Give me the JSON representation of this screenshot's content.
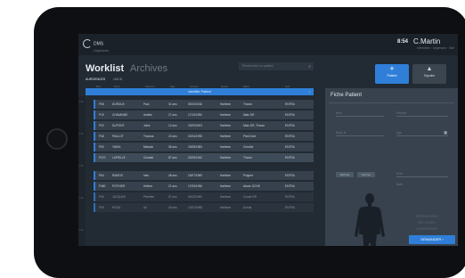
{
  "app": {
    "logo_line1": "DMS",
    "logo_line2": "Urgences"
  },
  "header": {
    "time": "8:54",
    "user": "C.Martin",
    "user_sub": "Infirmière · Urgences · Site"
  },
  "worklist": {
    "title": "Worklist",
    "alt_title": "Archives",
    "subtabs": [
      "AURGENCES",
      "UHCD"
    ],
    "search_placeholder": "Rechercher un patient",
    "column_headers": [
      "Box",
      "Nom",
      "Prénom",
      "Âge",
      "Arrivée",
      "Heure",
      "Motif",
      "IAO"
    ],
    "banner": "Identifier Patient",
    "time_labels": [
      "10h",
      "11h",
      "12h",
      "13h",
      "14h"
    ],
    "rows": [
      {
        "box": "P08",
        "name": "DUROUX",
        "first": "Paul",
        "age": "31 ans",
        "date": "05/10/2016",
        "loc": "Harlème",
        "motif": "Thorax",
        "status": "ENTRA"
      },
      {
        "box": "P19",
        "name": "CHAVANNE",
        "first": "Amélie",
        "age": "27 ans",
        "date": "17/10/1990",
        "loc": "Harlème",
        "motif": "Main DR",
        "status": "ENTRA"
      },
      {
        "box": "P20",
        "name": "DUPONT",
        "first": "Jules",
        "age": "12 ans",
        "date": "23/09/2003",
        "loc": "Harlème",
        "motif": "Main DR, Thorax",
        "status": "ENTRA"
      },
      {
        "box": "P48",
        "name": "PAILLOT",
        "first": "Thomas",
        "age": "22 ans",
        "date": "22/04/1995",
        "loc": "Harlème",
        "motif": "Pied Droit",
        "status": "ENTRA"
      },
      {
        "box": "P50",
        "name": "YAHIA",
        "first": "Mélanie",
        "age": "35 ans",
        "date": "23/08/1983",
        "loc": "Harlème",
        "motif": "Cheville",
        "status": "ENTRA"
      },
      {
        "box": "P470",
        "name": "LAPIELLE",
        "first": "Chantal",
        "age": "87 ans",
        "date": "22/05/1942",
        "loc": "Harlème",
        "motif": "Thorax",
        "status": "ENTRA"
      },
      {
        "box": "P64",
        "name": "RAMOS",
        "first": "Inès",
        "age": "48 ans",
        "date": "15/07/1969",
        "loc": "Harlème",
        "motif": "Poignet",
        "status": "ENTRA"
      },
      {
        "box": "P480",
        "name": "POTHIER",
        "first": "Hélène",
        "age": "21 ans",
        "date": "17/05/1996",
        "loc": "Harlème",
        "motif": "Abcès GCHE",
        "status": "ENTRA"
      },
      {
        "box": "P40",
        "name": "JACQUES",
        "first": "Pierrette",
        "age": "57 ans",
        "date": "05/12/1960",
        "loc": "Harlème",
        "motif": "Coude DR",
        "status": "ENTRA"
      },
      {
        "box": "P49",
        "name": "HODA",
        "first": "Ali",
        "age": "49 ans",
        "date": "12/01/1968",
        "loc": "Harlème",
        "motif": "Dorsal",
        "status": "ENTRA"
      }
    ]
  },
  "actions": {
    "new_label": "Patient",
    "new_icon": "+",
    "alert_label": "Signaler",
    "alert_icon": "▲"
  },
  "panel": {
    "title": "Fiche Patient",
    "fields": [
      "Nom",
      "Prénom",
      "Né(e) le",
      "Âge",
      "Sexe",
      "Motif"
    ],
    "chips": [
      "Homme",
      "Femme"
    ],
    "body_text": [
      "Sélectionner",
      "les zones",
      "concernées"
    ],
    "demand_button": "DEMANDER"
  },
  "colors": {
    "accent": "#2f7fd9",
    "screen_bg": "#222a33",
    "panel_bg": "#37424e"
  }
}
